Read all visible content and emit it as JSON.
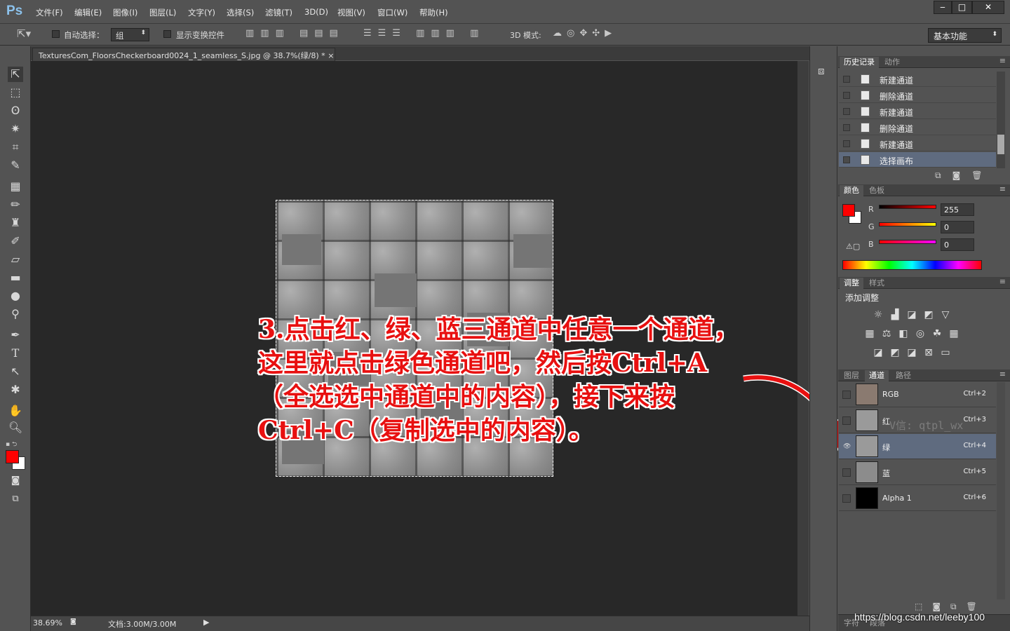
{
  "app": {
    "logo": "Ps"
  },
  "menu": [
    "文件(F)",
    "编辑(E)",
    "图像(I)",
    "图层(L)",
    "文字(Y)",
    "选择(S)",
    "滤镜(T)",
    "3D(D)",
    "视图(V)",
    "窗口(W)",
    "帮助(H)"
  ],
  "window_buttons": {
    "minimize": "‒",
    "restore": "□",
    "close": "✕"
  },
  "options": {
    "auto_select_label": "自动选择：",
    "auto_select_value": "组",
    "show_transform_label": "显示变换控件",
    "mode_3d_label": "3D 模式:",
    "workspace": "基本功能"
  },
  "document": {
    "tab_title": "TexturesCom_FloorsCheckerboard0024_1_seamless_S.jpg @ 38.7%(绿/8) *",
    "tab_close": "×"
  },
  "status": {
    "zoom": "38.69%",
    "doc_size": "文档:3.00M/3.00M"
  },
  "annotation": {
    "lines": [
      "3.点击红、绿、蓝三通道中任意一个通道，",
      " 这里就点击绿色通道吧，然后按Ctrl+A",
      "（全选选中通道中的内容），接下来按",
      " Ctrl+C（复制选中的内容）。"
    ]
  },
  "history_panel": {
    "tabs": [
      "历史记录",
      "动作"
    ],
    "items": [
      "新建通道",
      "删除通道",
      "新建通道",
      "删除通道",
      "新建通道",
      "选择画布"
    ],
    "selected_index": 5
  },
  "color_panel": {
    "tabs": [
      "颜色",
      "色板"
    ],
    "r_label": "R",
    "g_label": "G",
    "b_label": "B",
    "r": "255",
    "g": "0",
    "b": "0",
    "foreground": "#ff0000",
    "background": "#ffffff"
  },
  "adjust_panel": {
    "tabs": [
      "调整",
      "样式"
    ],
    "title": "添加调整"
  },
  "channels_panel": {
    "tabs": [
      "图层",
      "通道",
      "路径"
    ],
    "rows": [
      {
        "name": "RGB",
        "shortcut": "Ctrl+2"
      },
      {
        "name": "红",
        "shortcut": "Ctrl+3"
      },
      {
        "name": "绿",
        "shortcut": "Ctrl+4"
      },
      {
        "name": "蓝",
        "shortcut": "Ctrl+5"
      },
      {
        "name": "Alpha 1",
        "shortcut": "Ctrl+6"
      }
    ],
    "selected_index": 2,
    "watermark": "V信: qtpl_wx"
  },
  "bottom_tabs": {
    "left": "字符",
    "right": "段落"
  },
  "url_watermark": "https://blog.csdn.net/leeby100",
  "colors": {
    "accent_selected_row": "#5f6b7f",
    "annotation_red": "#e81010"
  }
}
